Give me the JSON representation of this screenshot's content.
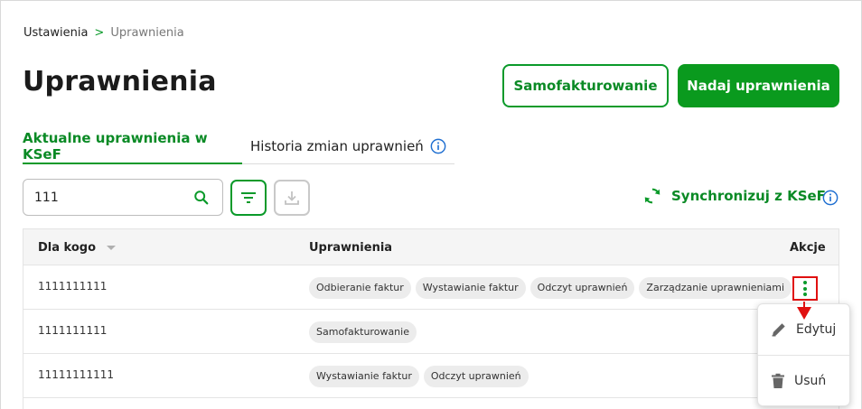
{
  "breadcrumb": {
    "root": "Ustawienia",
    "separator": ">",
    "current": "Uprawnienia"
  },
  "page": {
    "title": "Uprawnienia"
  },
  "actions": {
    "self_invoicing_label": "Samofakturowanie",
    "grant_label": "Nadaj uprawnienia"
  },
  "tabs": [
    {
      "label": "Aktualne uprawnienia w KSeF",
      "active": true
    },
    {
      "label": "Historia zmian uprawnień",
      "active": false
    }
  ],
  "toolbar": {
    "search_value": "111",
    "sync_label": "Synchronizuj z KSeF"
  },
  "table": {
    "columns": [
      "Dla kogo",
      "Uprawnienia",
      "Akcje"
    ],
    "rows": [
      {
        "who": "1111111111",
        "permissions": [
          "Odbieranie faktur",
          "Wystawianie faktur",
          "Odczyt uprawnień",
          "Zarządzanie uprawnieniami"
        ]
      },
      {
        "who": "1111111111",
        "permissions": [
          "Samofakturowanie"
        ]
      },
      {
        "who": "11111111111",
        "permissions": [
          "Wystawianie faktur",
          "Odczyt uprawnień"
        ]
      }
    ]
  },
  "row_menu": {
    "edit_label": "Edytuj",
    "delete_label": "Usuń"
  },
  "colors": {
    "brand_green": "#0a9a2a",
    "highlight_red": "#e01010"
  },
  "icons": [
    "chevron-right-icon",
    "info-icon",
    "search-icon",
    "filter-icon",
    "download-icon",
    "sync-icon",
    "sort-icon",
    "kebab-icon",
    "pencil-icon",
    "trash-icon"
  ]
}
